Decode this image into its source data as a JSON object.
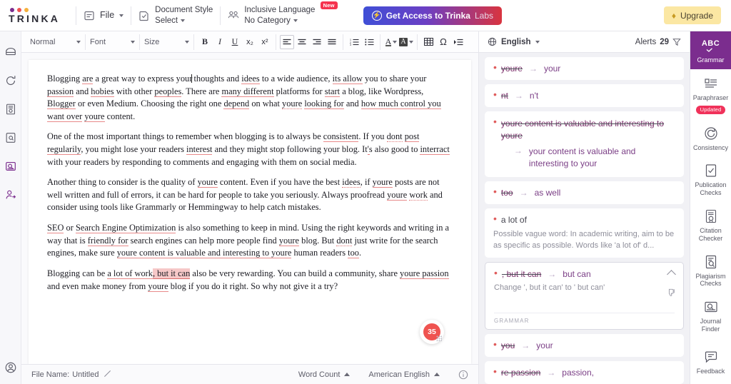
{
  "brand": {
    "name": "TRINKA",
    "dot_colors": [
      "#7b2d8e",
      "#ef5350",
      "#f5b13d"
    ]
  },
  "header": {
    "file_menu": {
      "label": "File",
      "icon": "file-icon"
    },
    "document_style": {
      "title": "Document Style",
      "value": "Select",
      "icon": "document-style-icon"
    },
    "inclusive_language": {
      "title": "Inclusive Language",
      "value": "No Category",
      "badge": "New",
      "icon": "people-icon"
    },
    "labs_button": {
      "label_bold": "Get Access to Trinka",
      "label_light": "Labs",
      "icon": "flash-icon"
    },
    "upgrade_button": {
      "label": "Upgrade",
      "icon": "diamond-icon"
    }
  },
  "left_rail": {
    "items": [
      {
        "name": "archive-icon",
        "active": false
      },
      {
        "name": "refresh-icon",
        "active": false
      },
      {
        "name": "certificate-icon",
        "active": false
      },
      {
        "name": "document-search-icon",
        "active": false
      },
      {
        "name": "journal-search-icon",
        "active": true
      }
    ],
    "bottom": {
      "name": "user-add-icon",
      "active": true
    }
  },
  "toolbar": {
    "style_select": "Normal",
    "font_select": "Font",
    "size_select": "Size",
    "buttons": [
      {
        "name": "bold-button",
        "glyph": "B"
      },
      {
        "name": "italic-button",
        "glyph": "I"
      },
      {
        "name": "underline-button",
        "glyph": "U"
      },
      {
        "name": "subscript-button",
        "glyph": "x₂"
      },
      {
        "name": "superscript-button",
        "glyph": "x²"
      },
      {
        "name": "align-left-button",
        "glyph": "align-left"
      },
      {
        "name": "align-center-button",
        "glyph": "align-center"
      },
      {
        "name": "align-right-button",
        "glyph": "align-right"
      },
      {
        "name": "align-justify-button",
        "glyph": "align-justify"
      },
      {
        "name": "ordered-list-button",
        "glyph": "ol"
      },
      {
        "name": "unordered-list-button",
        "glyph": "ul"
      },
      {
        "name": "text-color-button",
        "glyph": "A"
      },
      {
        "name": "highlight-color-button",
        "glyph": "A-fill"
      },
      {
        "name": "table-button",
        "glyph": "table"
      },
      {
        "name": "special-character-button",
        "glyph": "Ω"
      },
      {
        "name": "indent-button",
        "glyph": "indent"
      }
    ]
  },
  "document": {
    "paragraphs": [
      {
        "id": "p1",
        "runs": [
          {
            "t": "Blogging "
          },
          {
            "t": "are",
            "s": "u"
          },
          {
            "t": " a great way to express your"
          },
          {
            "t": "",
            "s": "caret"
          },
          {
            "t": " thoughts and "
          },
          {
            "t": "idees",
            "s": "u"
          },
          {
            "t": " to a wide audience, "
          },
          {
            "t": "its allow",
            "s": "u"
          },
          {
            "t": " you to share your "
          },
          {
            "t": "passion",
            "s": "u"
          },
          {
            "t": " and "
          },
          {
            "t": "hobies",
            "s": "u"
          },
          {
            "t": " with other "
          },
          {
            "t": "peoples",
            "s": "u"
          },
          {
            "t": ". There are "
          },
          {
            "t": "many different",
            "s": "u"
          },
          {
            "t": " platforms for "
          },
          {
            "t": "start",
            "s": "u"
          },
          {
            "t": " a blog, like Wordpress, "
          },
          {
            "t": "Blogger",
            "s": "u"
          },
          {
            "t": " or even Medium. Choosing the right one "
          },
          {
            "t": "depend",
            "s": "u"
          },
          {
            "t": " on what "
          },
          {
            "t": "youre",
            "s": "ud"
          },
          {
            "t": " "
          },
          {
            "t": "looking for",
            "s": "u"
          },
          {
            "t": " and "
          },
          {
            "t": "how much control you want over",
            "s": "u"
          },
          {
            "t": " "
          },
          {
            "t": "youre",
            "s": "u"
          },
          {
            "t": " content."
          }
        ]
      },
      {
        "id": "p2",
        "runs": [
          {
            "t": "One of the most important things to remember when blogging is to always be "
          },
          {
            "t": "consistent",
            "s": "u"
          },
          {
            "t": ". If you "
          },
          {
            "t": "dont",
            "s": "ud"
          },
          {
            "t": " "
          },
          {
            "t": "post",
            "s": "u"
          },
          {
            "t": " "
          },
          {
            "t": "regularily",
            "s": "u"
          },
          {
            "t": ", you might lose your readers "
          },
          {
            "t": "interest",
            "s": "u"
          },
          {
            "t": " and they might stop following your blog. It"
          },
          {
            "t": "'",
            "s": "ud"
          },
          {
            "t": "s also good to "
          },
          {
            "t": "interract",
            "s": "u"
          },
          {
            "t": " with your readers by responding to comments and engaging with them on social media."
          }
        ]
      },
      {
        "id": "p3",
        "runs": [
          {
            "t": "Another thing to consider is the quality of "
          },
          {
            "t": "youre",
            "s": "u"
          },
          {
            "t": " content. Even if you have the best "
          },
          {
            "t": "idees",
            "s": "ud"
          },
          {
            "t": ", if "
          },
          {
            "t": "youre",
            "s": "u"
          },
          {
            "t": " posts are not well written and full of errors, it can be hard for people to take you seriously. Always proofread "
          },
          {
            "t": "youre",
            "s": "u"
          },
          {
            "t": " "
          },
          {
            "t": "work",
            "s": "ud"
          },
          {
            "t": " and consider using tools like Grammarly or Hemmingway to help catch mistakes."
          }
        ]
      },
      {
        "id": "p4",
        "runs": [
          {
            "t": "SEO",
            "s": "u"
          },
          {
            "t": " or "
          },
          {
            "t": "Search Engine Optimization",
            "s": "u"
          },
          {
            "t": " is also something to keep in mind. Using the right keywords and writing in a way that is "
          },
          {
            "t": "friendly for",
            "s": "u"
          },
          {
            "t": " search engines can help more people find "
          },
          {
            "t": "youre",
            "s": "u"
          },
          {
            "t": " blog. But "
          },
          {
            "t": "dont",
            "s": "ud"
          },
          {
            "t": " just write for the search engines, make sure "
          },
          {
            "t": "youre content is valuable and interesting to youre",
            "s": "u"
          },
          {
            "t": " human readers "
          },
          {
            "t": "too",
            "s": "u"
          },
          {
            "t": "."
          }
        ]
      },
      {
        "id": "p5",
        "runs": [
          {
            "t": "Blogging can be "
          },
          {
            "t": "a lot of work",
            "s": "u"
          },
          {
            "t": ""
          },
          {
            "t": ", but it can",
            "s": "hl"
          },
          {
            "t": " also be very rewarding. You can build a community, share "
          },
          {
            "t": "youre passion",
            "s": "u"
          },
          {
            "t": " and even make money from "
          },
          {
            "t": "youre",
            "s": "u"
          },
          {
            "t": " blog if you do it right. So why not give it a try?"
          }
        ]
      }
    ],
    "floating_badge": {
      "count": "35",
      "name": "suggestions-fab"
    }
  },
  "statusbar": {
    "file_name_label": "File Name:",
    "file_name_value": "Untitled",
    "word_count": "Word Count",
    "language": "American English",
    "info_icon": "info-icon"
  },
  "suggestion_panel": {
    "language": "English",
    "alerts_label": "Alerts",
    "alerts_count": "29",
    "filter_icon": "filter-icon",
    "cards": [
      {
        "type": "simple",
        "wrong": "youre",
        "right": "your"
      },
      {
        "type": "simple",
        "wrong": "nt",
        "right": "n't"
      },
      {
        "type": "multi",
        "wrong": "youre content is valuable and interesting to youre",
        "right": "your content is valuable and interesting to your"
      },
      {
        "type": "simple",
        "wrong": "too",
        "right": "as well"
      },
      {
        "type": "vague",
        "wrong": "a lot of",
        "desc": "Possible vague word: In academic writing, aim to be as specific as possible. Words like 'a lot of' d..."
      },
      {
        "type": "expanded",
        "wrong": ", but it can",
        "right": "but can",
        "desc": "Change ', but it can' to ' but can'",
        "category": "GRAMMAR",
        "collapse_icon": "chevron-up-icon",
        "dislike_icon": "thumbs-down-icon"
      },
      {
        "type": "simple",
        "wrong": "you",
        "right": "your"
      },
      {
        "type": "simple",
        "wrong": "re passion",
        "right": "passion,"
      }
    ]
  },
  "right_rail": {
    "items": [
      {
        "label": "Grammar",
        "icon": "abc-check-icon",
        "active": true,
        "badge": null
      },
      {
        "label": "Paraphraser",
        "icon": "paraphraser-icon",
        "active": false,
        "badge": "Updated"
      },
      {
        "label": "Consistency",
        "icon": "consistency-icon",
        "active": false,
        "badge": null
      },
      {
        "label": "Publication Checks",
        "icon": "publication-checks-icon",
        "active": false,
        "badge": null
      },
      {
        "label": "Citation Checker",
        "icon": "citation-checker-icon",
        "active": false,
        "badge": null
      },
      {
        "label": "Plagiarism Checks",
        "icon": "plagiarism-checks-icon",
        "active": false,
        "badge": null
      },
      {
        "label": "Journal Finder",
        "icon": "journal-finder-icon",
        "active": false,
        "badge": null
      }
    ],
    "feedback": {
      "label": "Feedback",
      "icon": "feedback-icon"
    }
  }
}
